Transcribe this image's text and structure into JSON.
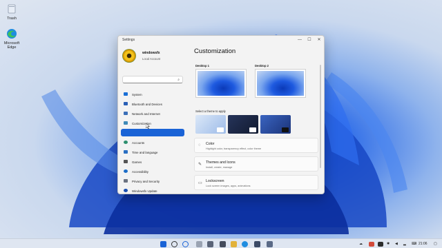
{
  "desktop": {
    "icons": [
      {
        "label": "Trash"
      },
      {
        "label": "Microsoft Edge"
      }
    ]
  },
  "window": {
    "title": "Settings",
    "controls": {
      "minimize": "—",
      "maximize": "☐",
      "close": "✕"
    }
  },
  "account": {
    "name": "windowsfx",
    "type": "Local Account"
  },
  "search": {
    "placeholder": "",
    "icon": "search-icon"
  },
  "nav": [
    {
      "label": "System",
      "icon": "system-icon",
      "color": "#1a6fd6"
    },
    {
      "label": "Bluetooth and Devices",
      "icon": "bluetooth-icon",
      "color": "#2a5fb5"
    },
    {
      "label": "Network and Internet",
      "icon": "network-icon",
      "color": "#3b6fb8"
    },
    {
      "label": "Customization",
      "icon": "brush-icon",
      "color": "#3f8ab8"
    },
    {
      "label": "",
      "icon": "",
      "color": "#1a63d6",
      "active": true
    },
    {
      "label": "Accounts",
      "icon": "accounts-icon",
      "color": "#2d8f6e"
    },
    {
      "label": "Time and language",
      "icon": "clock-icon",
      "color": "#2a6fc2"
    },
    {
      "label": "Games",
      "icon": "games-icon",
      "color": "#555555"
    },
    {
      "label": "Accessibility",
      "icon": "accessibility-icon",
      "color": "#1d6ec8"
    },
    {
      "label": "Privacy and Security",
      "icon": "shield-icon",
      "color": "#6b7280"
    },
    {
      "label": "Windowsfx Update",
      "icon": "update-icon",
      "color": "#1a4fb0"
    }
  ],
  "main": {
    "title": "Customization",
    "desktops": [
      {
        "label": "Desktop 1"
      },
      {
        "label": "Desktop 2"
      }
    ],
    "theme_prompt": "Select a theme to apply",
    "themes": [
      {
        "name": "light",
        "bg": "#cfe0f5",
        "chip": "#ffffff"
      },
      {
        "name": "dark",
        "bg": "#1e2a48",
        "chip": "#ffffff"
      },
      {
        "name": "glow",
        "bg": "#2b4fa0",
        "chip": "#111111"
      }
    ],
    "cards": [
      {
        "title": "Color",
        "subtitle": "Highlight color, transparency effect, color theme",
        "icon": "palette-icon"
      },
      {
        "title": "Themes and Icons",
        "subtitle": "Install, create, manage",
        "icon": "pen-icon"
      },
      {
        "title": "Lockscreen",
        "subtitle": "Lock screen images, apps, animations",
        "icon": "lockscreen-icon"
      }
    ]
  },
  "taskbar": {
    "time": "21:06",
    "accent": "#1a63d6"
  }
}
